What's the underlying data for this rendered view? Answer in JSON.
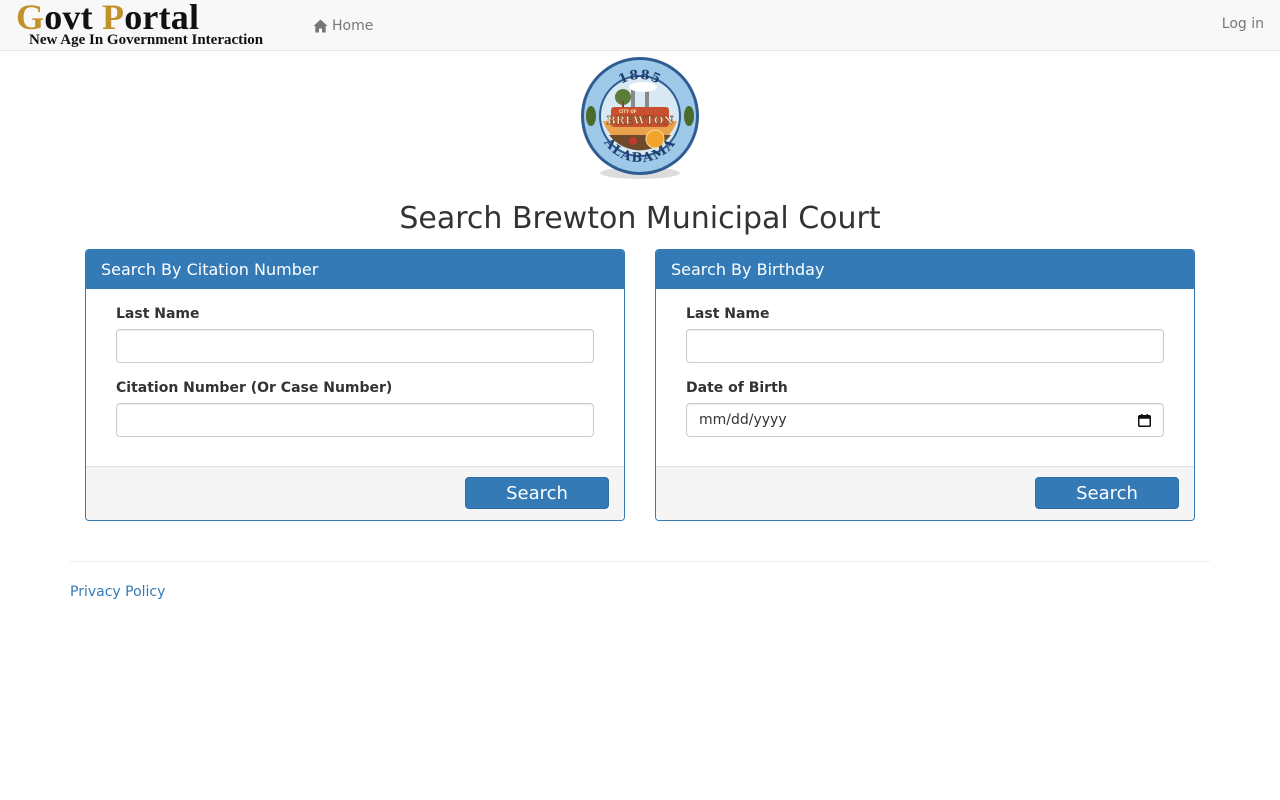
{
  "navbar": {
    "brand_govt_initial": "G",
    "brand_govt_rest": "ovt ",
    "brand_portal_initial": "P",
    "brand_portal_rest": "ortal",
    "brand_tagline": "New Age In Government Interaction",
    "home_label": "Home",
    "home_icon": "home-icon",
    "login_label": "Log in"
  },
  "seal": {
    "year": "1885",
    "city_small": "CITY OF",
    "city_name": "BREWTON",
    "state": "ALABAMA"
  },
  "page_title": "Search Brewton Municipal Court",
  "citation_panel": {
    "heading": "Search By Citation Number",
    "last_name_label": "Last Name",
    "last_name_value": "",
    "citation_label": "Citation Number (Or Case Number)",
    "citation_value": "",
    "search_label": "Search"
  },
  "birthday_panel": {
    "heading": "Search By Birthday",
    "last_name_label": "Last Name",
    "last_name_value": "",
    "dob_label": "Date of Birth",
    "dob_placeholder": "mm/dd/yyyy",
    "search_label": "Search"
  },
  "footer": {
    "privacy_label": "Privacy Policy"
  },
  "colors": {
    "primary": "#337ab7",
    "brand_gold": "#c2922a",
    "navbar_bg": "#f8f8f8",
    "nav_text": "#777777"
  }
}
